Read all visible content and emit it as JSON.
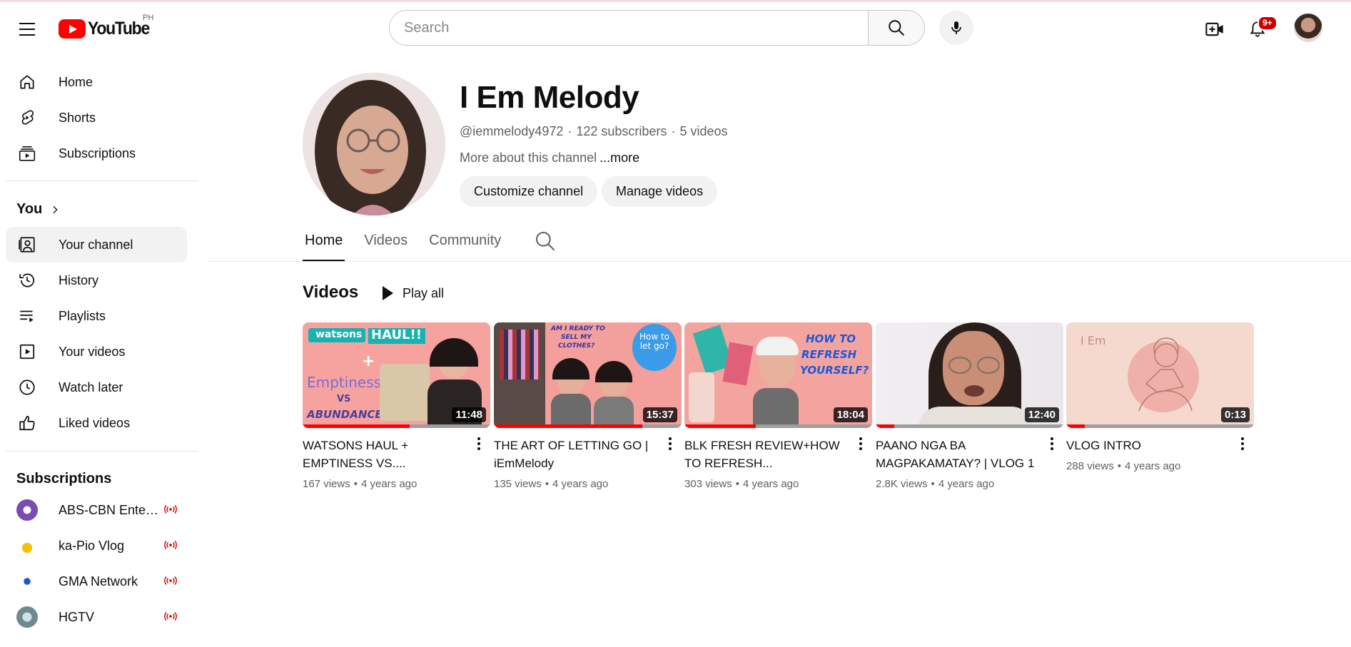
{
  "header": {
    "logo_text": "YouTube",
    "region": "PH",
    "search_placeholder": "Search",
    "notification_count": "9+"
  },
  "sidebar": {
    "main": [
      {
        "label": "Home",
        "icon": "home-icon"
      },
      {
        "label": "Shorts",
        "icon": "shorts-icon"
      },
      {
        "label": "Subscriptions",
        "icon": "subscriptions-icon"
      }
    ],
    "you_heading": "You",
    "you_items": [
      {
        "label": "Your channel",
        "icon": "your-channel-icon",
        "active": true
      },
      {
        "label": "History",
        "icon": "history-icon"
      },
      {
        "label": "Playlists",
        "icon": "playlists-icon"
      },
      {
        "label": "Your videos",
        "icon": "your-videos-icon"
      },
      {
        "label": "Watch later",
        "icon": "watch-later-icon"
      },
      {
        "label": "Liked videos",
        "icon": "liked-videos-icon"
      }
    ],
    "subscriptions_heading": "Subscriptions",
    "subscriptions": [
      {
        "label": "ABS-CBN Entertainment",
        "color": "#6a3fa0",
        "live": true
      },
      {
        "label": "ka-Pio Vlog",
        "color": "#f0c400",
        "live": true
      },
      {
        "label": "GMA Network",
        "color": "#1e5bbf",
        "live": true
      },
      {
        "label": "HGTV",
        "color": "#6f8a8f",
        "live": true
      }
    ]
  },
  "channel": {
    "name": "I Em Melody",
    "handle": "@iemmelody4972",
    "subscribers": "122 subscribers",
    "video_count": "5 videos",
    "about": "More about this channel",
    "more": "...more",
    "customize_label": "Customize channel",
    "manage_label": "Manage videos"
  },
  "tabs": [
    {
      "label": "Home",
      "active": true
    },
    {
      "label": "Videos"
    },
    {
      "label": "Community"
    }
  ],
  "shelf": {
    "title": "Videos",
    "play_all": "Play all",
    "videos": [
      {
        "title": "WATSONS HAUL + EMPTINESS VS....",
        "duration": "11:48",
        "views": "167 views",
        "age": "4 years ago",
        "progress": 0.57
      },
      {
        "title": "THE ART OF LETTING GO | iEmMelody",
        "duration": "15:37",
        "views": "135 views",
        "age": "4 years ago",
        "progress": 0.79
      },
      {
        "title": "BLK FRESH REVIEW+HOW TO REFRESH...",
        "duration": "18:04",
        "views": "303 views",
        "age": "4 years ago",
        "progress": 0.38
      },
      {
        "title": "PAANO NGA BA MAGPAKAMATAY? | VLOG 1",
        "duration": "12:40",
        "views": "2.8K views",
        "age": "4 years ago",
        "progress": 0.1
      },
      {
        "title": "VLOG INTRO",
        "duration": "0:13",
        "views": "288 views",
        "age": "4 years ago",
        "progress": 0.1
      }
    ]
  },
  "thumbnail_text": {
    "t1_brand": "watsons",
    "t1_haul": "HAUL!!",
    "t1_emptiness": "Emptiness",
    "t1_vs": "VS",
    "t1_abundance": "ABUNDANCE",
    "t2_line1": "AM I READY TO",
    "t2_line2": "SELL MY",
    "t2_line3": "CLOTHES?",
    "t2_bubble": "How to let go?",
    "t3_line1": "HOW TO",
    "t3_line2": "REFRESH",
    "t3_line3": "YOURSELF?",
    "t5_text": "I Em"
  },
  "colors": {
    "brand_red": "#ff0000",
    "text_primary": "#0f0f0f",
    "text_secondary": "#606060",
    "chip_bg": "#f2f2f2"
  }
}
